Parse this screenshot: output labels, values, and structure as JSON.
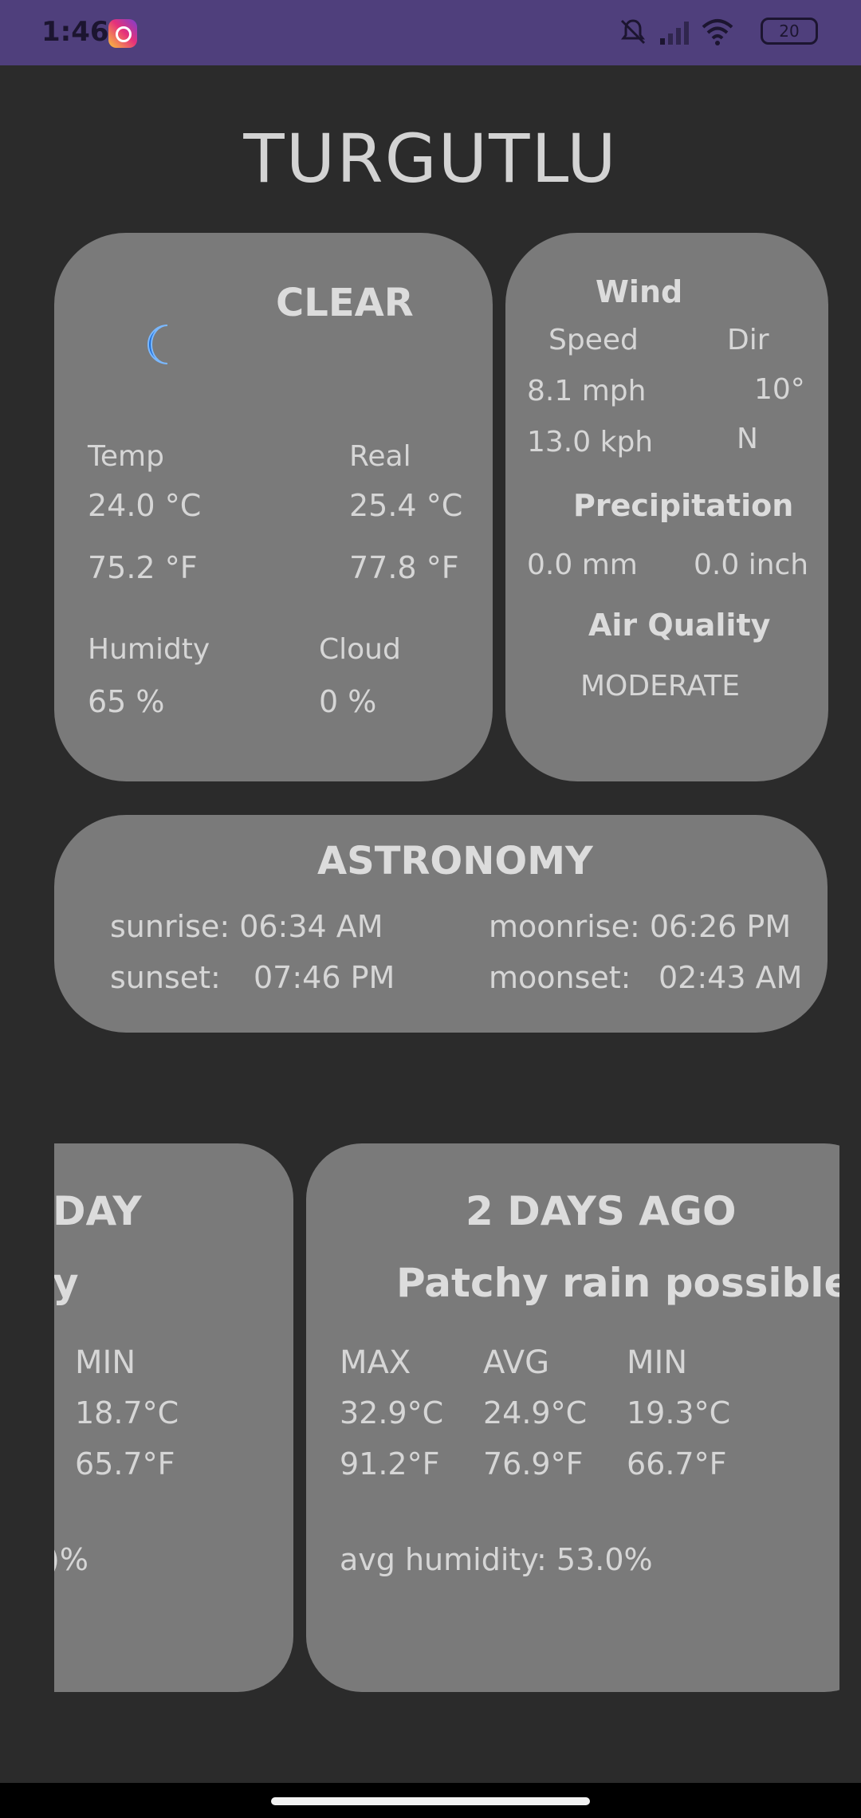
{
  "status_bar": {
    "time": "1:46",
    "battery": "20"
  },
  "city": "TURGUTLU",
  "current": {
    "condition": "CLEAR",
    "temp_label": "Temp",
    "real_label": "Real",
    "temp_c": "24.0 °C",
    "temp_f": "75.2 °F",
    "real_c": "25.4 °C",
    "real_f": "77.8 °F",
    "humidity_label": "Humidty",
    "humidity": "65 %",
    "cloud_label": "Cloud",
    "cloud": "0 %"
  },
  "wind": {
    "title": "Wind",
    "speed_label": "Speed",
    "dir_label": "Dir",
    "mph": "8.1  mph",
    "kph": "13.0 kph",
    "degree": "10°",
    "dir": "N",
    "precip_title": "Precipitation",
    "precip_mm": "0.0 mm",
    "precip_inch": "0.0 inch",
    "aq_title": "Air Quality",
    "aq_value": "MODERATE"
  },
  "astronomy": {
    "title": "ASTRONOMY",
    "sunrise": "sunrise: 06:34 AM",
    "sunset_label": "sunset:",
    "sunset_time": "07:46 PM",
    "moonrise": "moonrise: 06:26 PM",
    "moonset_label": "moonset:",
    "moonset_time": "02:43 AM"
  },
  "history": [
    {
      "title_partial": "DAY",
      "condition_partial": "y",
      "min_label": "MIN",
      "min_c": "18.7°C",
      "min_f": "65.7°F",
      "humidity_partial": ")%"
    },
    {
      "title": "2 DAYS AGO",
      "condition": "Patchy rain possible",
      "max_label": "MAX",
      "avg_label": "AVG",
      "min_label": "MIN",
      "max_c": "32.9°C",
      "avg_c": "24.9°C",
      "min_c": "19.3°C",
      "max_f": "91.2°F",
      "avg_f": "76.9°F",
      "min_f": "66.7°F",
      "avg_humidity": "avg humidity: 53.0%"
    }
  ],
  "colors": {
    "background": "#2b2b2b",
    "card": "#7a7a7a",
    "status_bar": "#4f3f7c",
    "moon": "#1f6fd6"
  }
}
